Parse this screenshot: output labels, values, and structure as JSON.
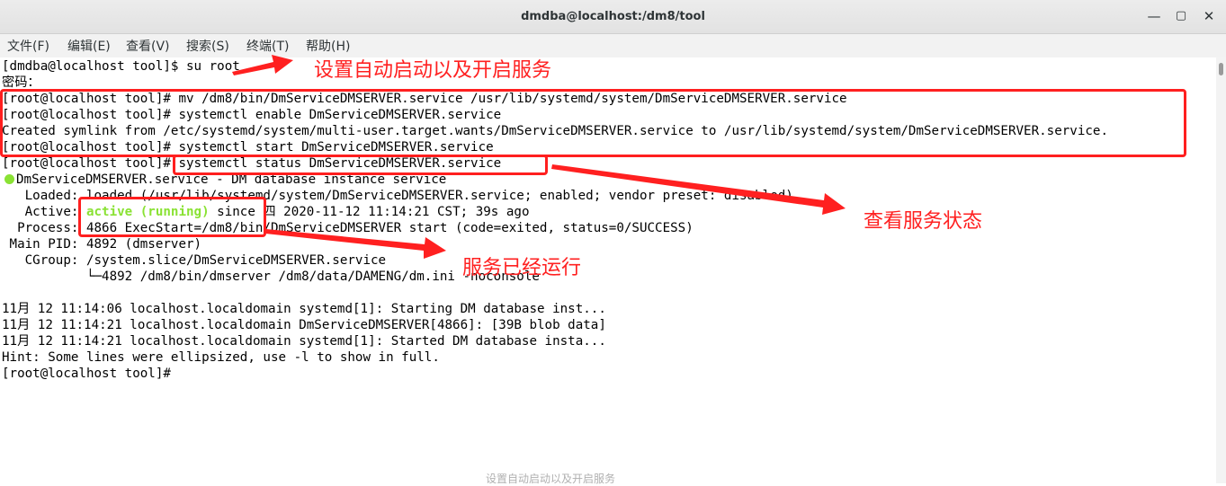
{
  "window": {
    "title": "dmdba@localhost:/dm8/tool",
    "minimize_glyph": "—",
    "maximize_glyph": "▢",
    "close_glyph": "✕"
  },
  "menu": {
    "items": [
      "文件(F)",
      "编辑(E)",
      "查看(V)",
      "搜索(S)",
      "终端(T)",
      "帮助(H)"
    ]
  },
  "terminal": {
    "lines": [
      "[dmdba@localhost tool]$ su root",
      "密码：",
      "[root@localhost tool]# mv /dm8/bin/DmServiceDMSERVER.service /usr/lib/systemd/system/DmServiceDMSERVER.service",
      "[root@localhost tool]# systemctl enable DmServiceDMSERVER.service",
      "Created symlink from /etc/systemd/system/multi-user.target.wants/DmServiceDMSERVER.service to /usr/lib/systemd/system/DmServiceDMSERVER.service.",
      "[root@localhost tool]# systemctl start DmServiceDMSERVER.service",
      "[root@localhost tool]# systemctl status DmServiceDMSERVER.service",
      "DmServiceDMSERVER.service - DM database instance service",
      "   Loaded: loaded (/usr/lib/systemd/system/DmServiceDMSERVER.service; enabled; vendor preset: disabled)",
      "",
      "  Process: 4866 ExecStart=/dm8/bin/DmServiceDMSERVER start (code=exited, status=0/SUCCESS)",
      " Main PID: 4892 (dmserver)",
      "   CGroup: /system.slice/DmServiceDMSERVER.service",
      "           └─4892 /dm8/bin/dmserver /dm8/data/DAMENG/dm.ini -noconsole",
      "",
      "11月 12 11:14:06 localhost.localdomain systemd[1]: Starting DM database inst...",
      "11月 12 11:14:21 localhost.localdomain DmServiceDMSERVER[4866]: [39B blob data]",
      "11月 12 11:14:21 localhost.localdomain systemd[1]: Started DM database insta...",
      "Hint: Some lines were ellipsized, use -l to show in full.",
      "[root@localhost tool]#"
    ],
    "active_line": {
      "prefix": "   Active: ",
      "status": "active (running)",
      "suffix": " since 四 2020-11-12 11:14:21 CST; 39s ago"
    }
  },
  "annotations": {
    "enable_start": "设置自动启动以及开启服务",
    "check_status": "查看服务状态",
    "running": "服务已经运行",
    "color": "#ff2020"
  },
  "background_text": "设置自动启动以及开启服务"
}
